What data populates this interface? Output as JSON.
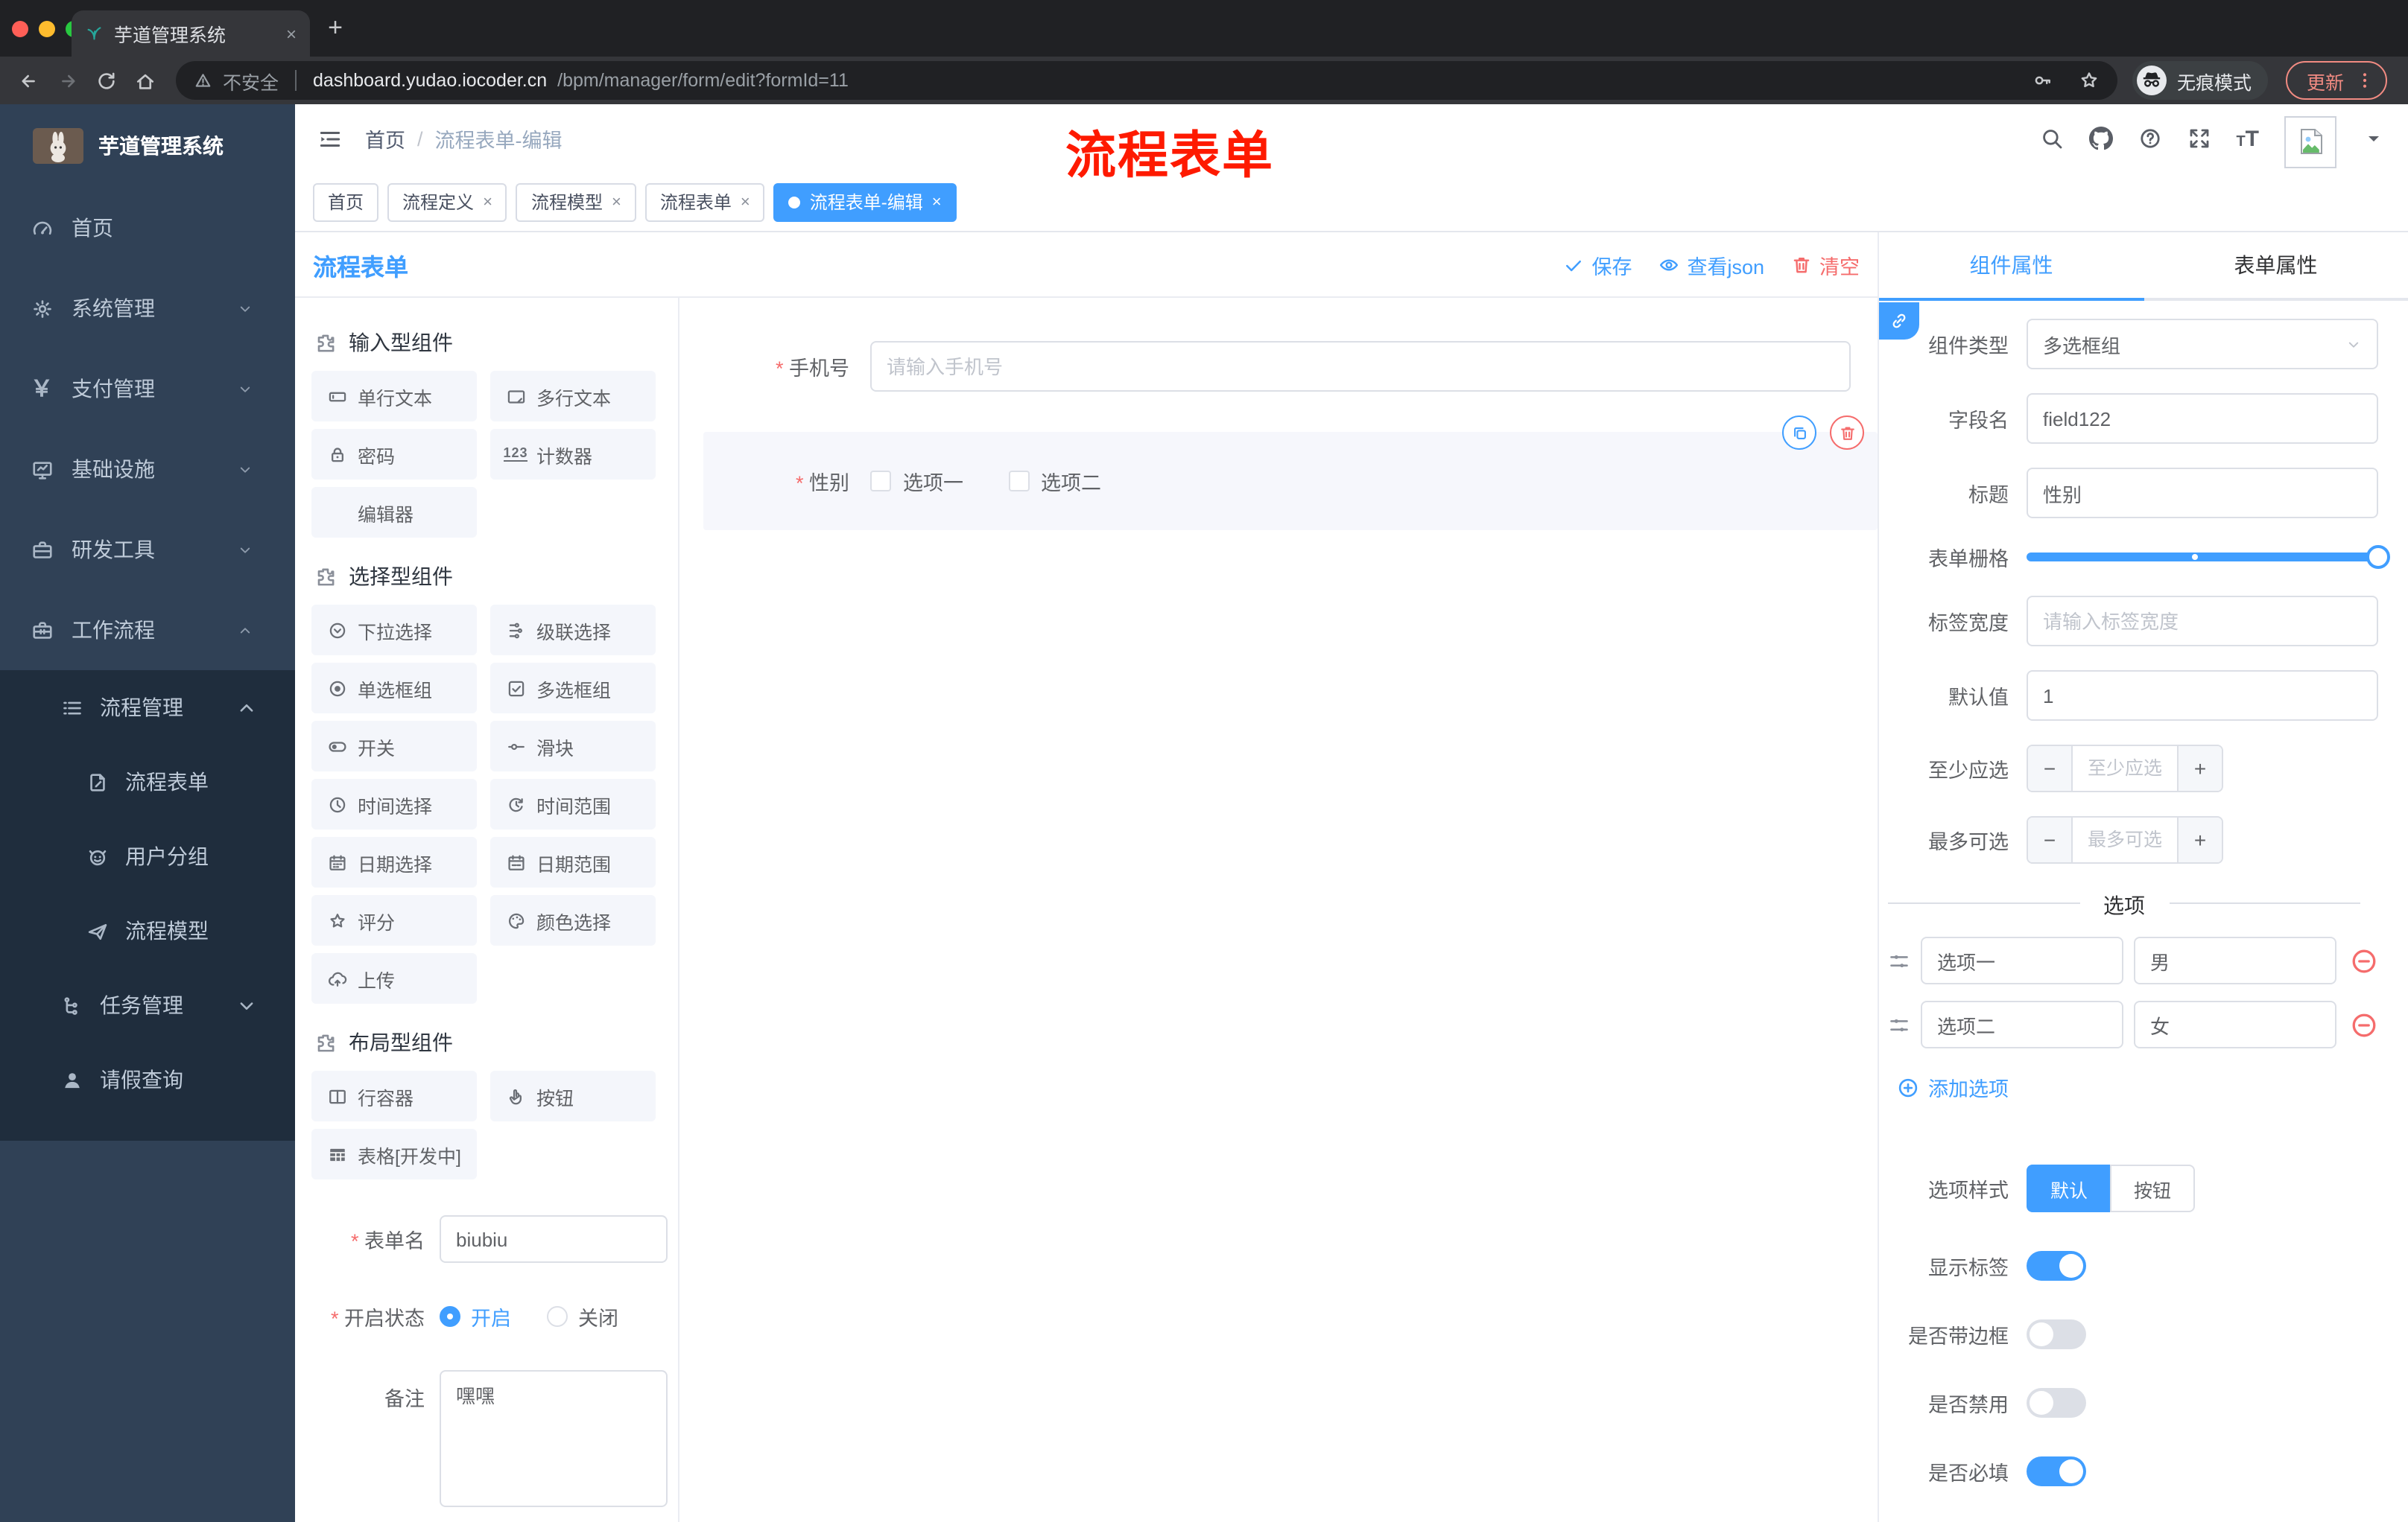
{
  "browser": {
    "tab_title": "芋道管理系统",
    "not_secure": "不安全",
    "url_host": "dashboard.yudao.iocoder.cn",
    "url_path": "/bpm/manager/form/edit?formId=11",
    "incognito_label": "无痕模式",
    "update_label": "更新"
  },
  "annotation": {
    "text": "流程表单",
    "color": "#fe1a00"
  },
  "sidebar": {
    "logo_title": "芋道管理系统",
    "menu": [
      {
        "label": "首页"
      },
      {
        "label": "系统管理"
      },
      {
        "label": "支付管理"
      },
      {
        "label": "基础设施"
      },
      {
        "label": "研发工具"
      },
      {
        "label": "工作流程"
      }
    ],
    "workflow_submenu": {
      "process_mgmt": {
        "label": "流程管理"
      },
      "children": [
        {
          "label": "流程表单"
        },
        {
          "label": "用户分组"
        },
        {
          "label": "流程模型"
        }
      ],
      "task_mgmt": {
        "label": "任务管理"
      },
      "leave_query": {
        "label": "请假查询"
      }
    }
  },
  "navbar": {
    "breadcrumb_home": "首页",
    "breadcrumb_current": "流程表单-编辑"
  },
  "tags": [
    {
      "label": "首页"
    },
    {
      "label": "流程定义"
    },
    {
      "label": "流程模型"
    },
    {
      "label": "流程表单"
    },
    {
      "label": "流程表单-编辑"
    }
  ],
  "designer": {
    "title": "流程表单",
    "save": "保存",
    "view_json": "查看json",
    "clear": "清空"
  },
  "components_panel": {
    "sections": [
      {
        "title": "输入型组件",
        "items": [
          {
            "label": "单行文本"
          },
          {
            "label": "多行文本"
          },
          {
            "label": "密码"
          },
          {
            "label": "计数器"
          },
          {
            "label": "编辑器"
          }
        ]
      },
      {
        "title": "选择型组件",
        "items": [
          {
            "label": "下拉选择"
          },
          {
            "label": "级联选择"
          },
          {
            "label": "单选框组"
          },
          {
            "label": "多选框组"
          },
          {
            "label": "开关"
          },
          {
            "label": "滑块"
          },
          {
            "label": "时间选择"
          },
          {
            "label": "时间范围"
          },
          {
            "label": "日期选择"
          },
          {
            "label": "日期范围"
          },
          {
            "label": "评分"
          },
          {
            "label": "颜色选择"
          },
          {
            "label": "上传"
          }
        ]
      },
      {
        "title": "布局型组件",
        "items": [
          {
            "label": "行容器"
          },
          {
            "label": "按钮"
          },
          {
            "label": "表格[开发中]"
          }
        ]
      }
    ],
    "form": {
      "name_label": "表单名",
      "name_value": "biubiu",
      "status_label": "开启状态",
      "status_on": "开启",
      "status_off": "关闭",
      "remark_label": "备注",
      "remark_value": "嘿嘿"
    }
  },
  "canvas": {
    "phone": {
      "label": "手机号",
      "placeholder": "请输入手机号"
    },
    "gender": {
      "label": "性别",
      "options": [
        "选项一",
        "选项二"
      ]
    }
  },
  "props_panel": {
    "tab_component": "组件属性",
    "tab_form": "表单属性",
    "fields": {
      "type_label": "组件类型",
      "type_value": "多选框组",
      "field_label": "字段名",
      "field_value": "field122",
      "title_label": "标题",
      "title_value": "性别",
      "grid_label": "表单栅格",
      "labelwidth_label": "标签宽度",
      "labelwidth_placeholder": "请输入标签宽度",
      "default_label": "默认值",
      "default_value": "1",
      "min_label": "至少应选",
      "min_placeholder": "至少应选",
      "max_label": "最多可选",
      "max_placeholder": "最多可选"
    },
    "options": {
      "divider": "选项",
      "rows": [
        {
          "label": "选项一",
          "value": "男"
        },
        {
          "label": "选项二",
          "value": "女"
        }
      ],
      "add": "添加选项"
    },
    "style": {
      "label": "选项样式",
      "seg_default": "默认",
      "seg_button": "按钮"
    },
    "switches": [
      {
        "label": "显示标签",
        "on": true
      },
      {
        "label": "是否带边框",
        "on": false
      },
      {
        "label": "是否禁用",
        "on": false
      },
      {
        "label": "是否必填",
        "on": true
      }
    ]
  },
  "colors": {
    "primary": "#409eff",
    "danger": "#f56c6c",
    "sidebar": "#304156",
    "submenu": "#1f2d3d"
  }
}
